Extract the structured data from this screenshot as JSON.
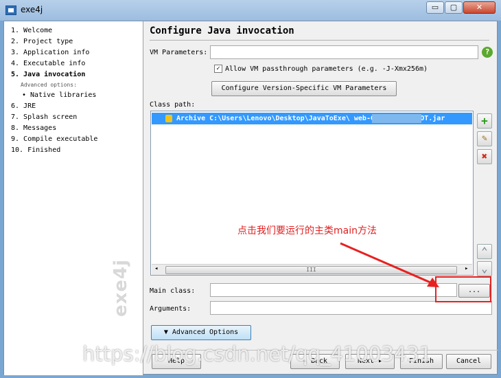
{
  "window": {
    "title": "exe4j",
    "minimize": "▭",
    "maximize": "▢",
    "close": "✕"
  },
  "steps": [
    {
      "label": "1. Welcome"
    },
    {
      "label": "2. Project type"
    },
    {
      "label": "3. Application info"
    },
    {
      "label": "4. Executable info"
    },
    {
      "label": "5. Java invocation"
    },
    {
      "label": "Advanced options:"
    },
    {
      "label": "• Native libraries"
    },
    {
      "label": "6. JRE"
    },
    {
      "label": "7. Splash screen"
    },
    {
      "label": "8. Messages"
    },
    {
      "label": "9. Compile executable"
    },
    {
      "label": "10. Finished"
    }
  ],
  "side_watermark": "exe4j",
  "page": {
    "heading": "Configure Java invocation",
    "vm_label": "VM Parameters:",
    "vm_value": "",
    "help": "?",
    "allow_check": "✓",
    "allow_label": "Allow VM passthrough parameters (e.g. -J-Xmx256m)",
    "config_button": "Configure Version-Specific VM Parameters",
    "classpath_label": "Class path:",
    "classpath_entry": "Archive C:\\Users\\Lenovo\\Desktop\\JavaToExe\\          web-0.0.1-SNAPSHOT.jar",
    "scroll_left": "◂",
    "scroll_right": "▸",
    "scroll_grip": "III",
    "add": "+",
    "edit": "✎",
    "remove": "✖",
    "up": "⌃",
    "down": "⌄",
    "main_class_label": "Main class:",
    "main_class_value": "",
    "browse": "...",
    "arguments_label": "Arguments:",
    "arguments_value": "",
    "advanced_button": "▼ Advanced Options",
    "annotation": "点击我们要运行的主类main方法"
  },
  "footer": {
    "help": "Help",
    "back": "◂ Back",
    "next": "Next ▸",
    "finish": "Finish",
    "cancel": "Cancel"
  },
  "csdn_watermark": "https://blog.csdn.net/qq_41003431"
}
